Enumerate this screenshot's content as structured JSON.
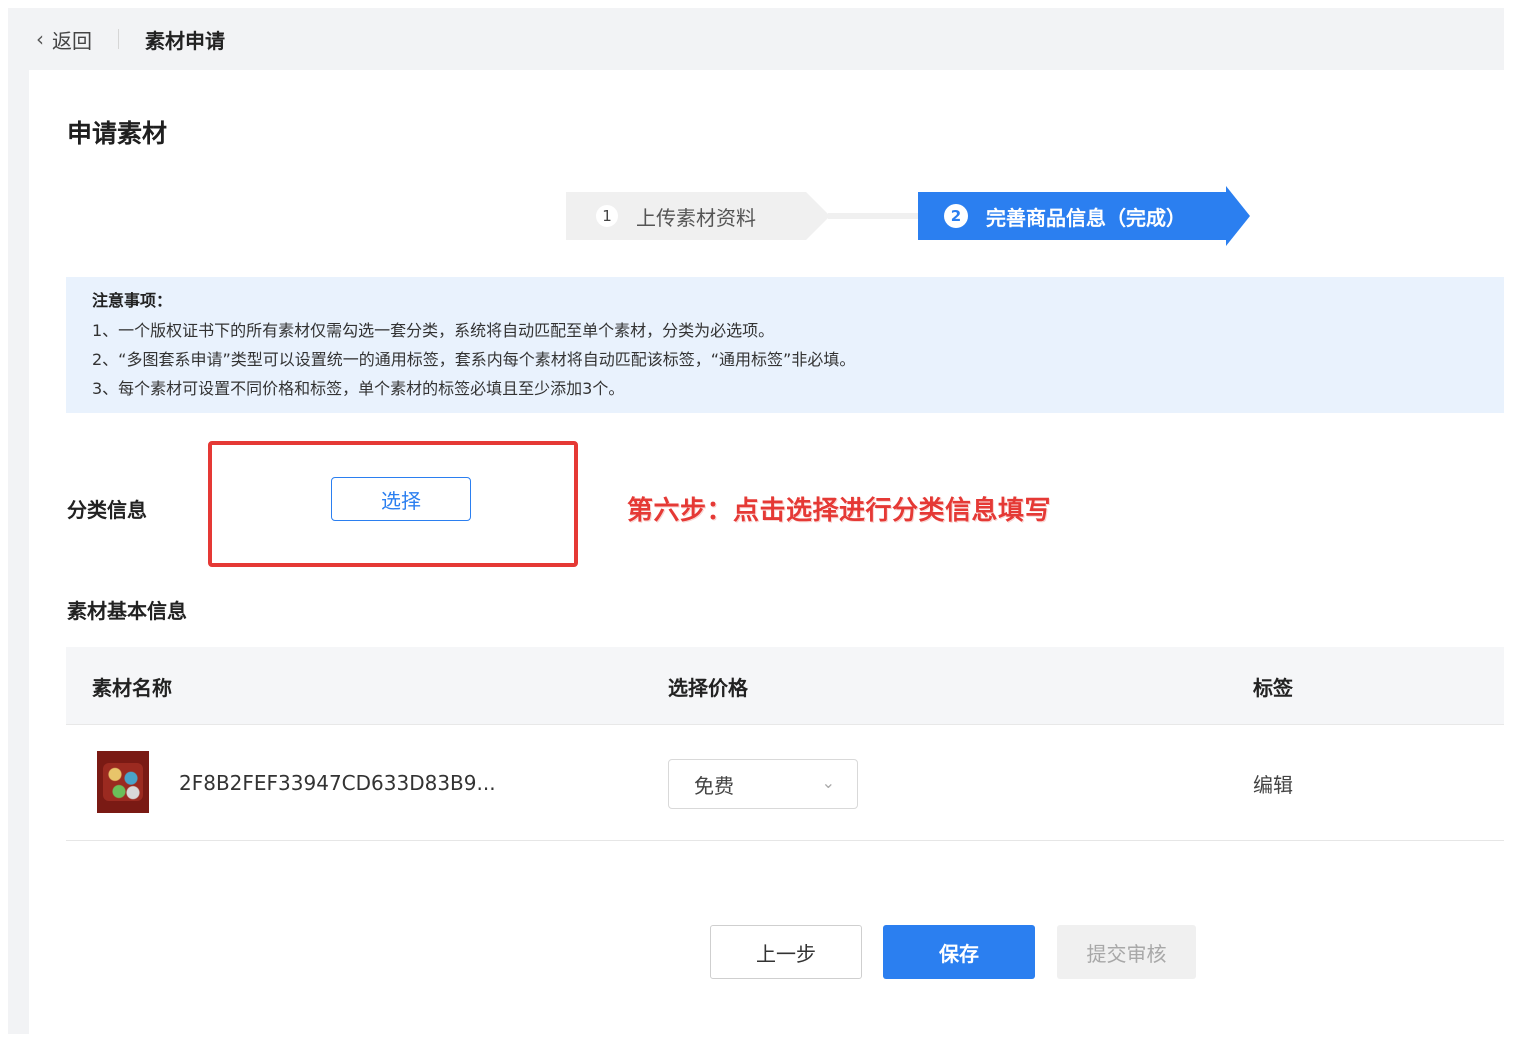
{
  "topbar": {
    "back_label": "返回",
    "breadcrumb_title": "素材申请"
  },
  "page": {
    "title": "申请素材"
  },
  "steps": [
    {
      "number": "1",
      "label": "上传素材资料",
      "active": false
    },
    {
      "number": "2",
      "label": "完善商品信息（完成）",
      "active": true
    }
  ],
  "notice": {
    "title": "注意事项：",
    "lines": [
      "1、一个版权证书下的所有素材仅需勾选一套分类，系统将自动匹配至单个素材，分类为必选项。",
      "2、“多图套系申请”类型可以设置统一的通用标签，套系内每个素材将自动匹配该标签，“通用标签”非必填。",
      "3、每个素材可设置不同价格和标签，单个素材的标签必填且至少添加3个。"
    ]
  },
  "category": {
    "label": "分类信息",
    "select_button": "选择",
    "annotation": "第六步：点击选择进行分类信息填写"
  },
  "basic_info": {
    "label": "素材基本信息",
    "columns": [
      "素材名称",
      "选择价格",
      "标签"
    ],
    "rows": [
      {
        "name": "2F8B2FEF33947CD633D83B9...",
        "price": "免费",
        "tag_action": "编辑"
      }
    ]
  },
  "actions": {
    "prev": "上一步",
    "save": "保存",
    "submit": "提交审核"
  },
  "colors": {
    "primary": "#2b7ff0",
    "annotation_red": "#e53935",
    "notice_bg": "#e9f2fd"
  }
}
